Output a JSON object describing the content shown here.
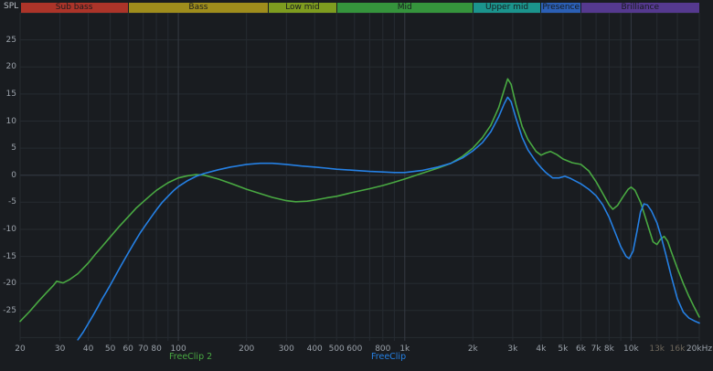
{
  "chart_data": {
    "type": "line",
    "title": "",
    "legend_position": "bottom",
    "colors": {
      "background": "#191c20",
      "grid": "#262b31",
      "grid_major": "#343a43",
      "grid_zero": "#363d46",
      "axis_text": "#9aa1a9"
    },
    "x_axis": {
      "scale": "log",
      "min": 20,
      "max": 20000,
      "unit": "Hz",
      "gridlines": [
        20,
        30,
        40,
        50,
        60,
        70,
        80,
        90,
        100,
        200,
        300,
        400,
        500,
        600,
        700,
        800,
        900,
        1000,
        2000,
        3000,
        4000,
        5000,
        6000,
        7000,
        8000,
        9000,
        10000,
        13000,
        16000,
        20000
      ],
      "major": [
        100,
        1000,
        10000
      ],
      "ticks": [
        {
          "f": 20,
          "label": "20"
        },
        {
          "f": 30,
          "label": "30"
        },
        {
          "f": 40,
          "label": "40"
        },
        {
          "f": 50,
          "label": "50"
        },
        {
          "f": 60,
          "label": "60"
        },
        {
          "f": 70,
          "label": "70"
        },
        {
          "f": 80,
          "label": "80"
        },
        {
          "f": 100,
          "label": "100"
        },
        {
          "f": 200,
          "label": "200"
        },
        {
          "f": 300,
          "label": "300"
        },
        {
          "f": 400,
          "label": "400"
        },
        {
          "f": 500,
          "label": "500"
        },
        {
          "f": 600,
          "label": "600"
        },
        {
          "f": 800,
          "label": "800"
        },
        {
          "f": 1000,
          "label": "1k"
        },
        {
          "f": 2000,
          "label": "2k"
        },
        {
          "f": 3000,
          "label": "3k"
        },
        {
          "f": 4000,
          "label": "4k"
        },
        {
          "f": 5000,
          "label": "5k"
        },
        {
          "f": 6000,
          "label": "6k"
        },
        {
          "f": 7000,
          "label": "7k"
        },
        {
          "f": 8000,
          "label": "8k"
        },
        {
          "f": 10000,
          "label": "10k"
        },
        {
          "f": 13000,
          "label": "13k",
          "dim": true
        },
        {
          "f": 16000,
          "label": "16k",
          "dim": true
        },
        {
          "f": 20000,
          "label": "20kHz"
        }
      ]
    },
    "y_axis": {
      "title": "SPL",
      "unit": "dB",
      "min": -30.6,
      "max": 30.0,
      "grid_step": 5,
      "ticks": [
        "25",
        "20",
        "15",
        "10",
        "5",
        "0",
        "-5",
        "-10",
        "-15",
        "-20",
        "-25"
      ]
    },
    "bands": [
      {
        "label": "Sub bass",
        "from": 20,
        "to": 60,
        "color": "#ac3429"
      },
      {
        "label": "Bass",
        "from": 60,
        "to": 250,
        "color": "#9f8d1c"
      },
      {
        "label": "Low mid",
        "from": 250,
        "to": 500,
        "color": "#7e9c1f"
      },
      {
        "label": "Mid",
        "from": 500,
        "to": 2000,
        "color": "#35943c"
      },
      {
        "label": "Upper mid",
        "from": 2000,
        "to": 4000,
        "color": "#1b948d"
      },
      {
        "label": "Presence",
        "from": 4000,
        "to": 6000,
        "color": "#2b5fb5"
      },
      {
        "label": "Brilliance",
        "from": 6000,
        "to": 20000,
        "color": "#55398f"
      }
    ],
    "series": [
      {
        "name": "FreeClip 2",
        "color": "#49a942",
        "points": [
          [
            20,
            -27.0
          ],
          [
            22,
            -25.2
          ],
          [
            24,
            -23.4
          ],
          [
            26,
            -21.8
          ],
          [
            28,
            -20.4
          ],
          [
            29,
            -19.6
          ],
          [
            31,
            -19.9
          ],
          [
            33,
            -19.3
          ],
          [
            36,
            -18.2
          ],
          [
            38,
            -17.2
          ],
          [
            40,
            -16.2
          ],
          [
            43,
            -14.6
          ],
          [
            46,
            -13.2
          ],
          [
            50,
            -11.4
          ],
          [
            55,
            -9.4
          ],
          [
            60,
            -7.7
          ],
          [
            65,
            -6.1
          ],
          [
            70,
            -4.9
          ],
          [
            75,
            -3.8
          ],
          [
            80,
            -2.8
          ],
          [
            90,
            -1.4
          ],
          [
            100,
            -0.5
          ],
          [
            110,
            -0.1
          ],
          [
            120,
            0.1
          ],
          [
            130,
            0.0
          ],
          [
            150,
            -0.7
          ],
          [
            170,
            -1.5
          ],
          [
            200,
            -2.6
          ],
          [
            230,
            -3.4
          ],
          [
            260,
            -4.1
          ],
          [
            300,
            -4.7
          ],
          [
            330,
            -4.9
          ],
          [
            370,
            -4.8
          ],
          [
            400,
            -4.6
          ],
          [
            450,
            -4.2
          ],
          [
            500,
            -3.9
          ],
          [
            600,
            -3.1
          ],
          [
            700,
            -2.5
          ],
          [
            800,
            -1.9
          ],
          [
            900,
            -1.3
          ],
          [
            1000,
            -0.7
          ],
          [
            1200,
            0.4
          ],
          [
            1400,
            1.3
          ],
          [
            1600,
            2.2
          ],
          [
            1800,
            3.5
          ],
          [
            2000,
            5.0
          ],
          [
            2200,
            6.9
          ],
          [
            2400,
            9.2
          ],
          [
            2600,
            12.5
          ],
          [
            2750,
            15.8
          ],
          [
            2850,
            17.8
          ],
          [
            2950,
            16.8
          ],
          [
            3100,
            13.0
          ],
          [
            3300,
            9.0
          ],
          [
            3500,
            6.6
          ],
          [
            3800,
            4.4
          ],
          [
            4000,
            3.7
          ],
          [
            4200,
            4.1
          ],
          [
            4400,
            4.4
          ],
          [
            4700,
            3.8
          ],
          [
            5000,
            3.0
          ],
          [
            5500,
            2.3
          ],
          [
            6000,
            2.0
          ],
          [
            6500,
            0.8
          ],
          [
            7000,
            -1.2
          ],
          [
            7500,
            -3.4
          ],
          [
            8000,
            -5.5
          ],
          [
            8300,
            -6.3
          ],
          [
            8700,
            -5.6
          ],
          [
            9200,
            -4.0
          ],
          [
            9700,
            -2.6
          ],
          [
            10000,
            -2.2
          ],
          [
            10400,
            -2.8
          ],
          [
            11000,
            -5.0
          ],
          [
            11500,
            -7.5
          ],
          [
            12000,
            -10.0
          ],
          [
            12500,
            -12.3
          ],
          [
            13000,
            -12.8
          ],
          [
            13500,
            -11.8
          ],
          [
            14000,
            -11.3
          ],
          [
            14500,
            -12.2
          ],
          [
            15000,
            -14.0
          ],
          [
            16000,
            -17.2
          ],
          [
            17000,
            -20.0
          ],
          [
            18000,
            -22.4
          ],
          [
            19000,
            -24.4
          ],
          [
            20000,
            -26.2
          ]
        ]
      },
      {
        "name": "FreeClip",
        "color": "#2580e4",
        "points": [
          [
            36,
            -30.4
          ],
          [
            38,
            -29.0
          ],
          [
            40,
            -27.4
          ],
          [
            42,
            -25.9
          ],
          [
            44,
            -24.4
          ],
          [
            46,
            -22.9
          ],
          [
            48,
            -21.6
          ],
          [
            50,
            -20.3
          ],
          [
            53,
            -18.4
          ],
          [
            56,
            -16.6
          ],
          [
            60,
            -14.4
          ],
          [
            64,
            -12.4
          ],
          [
            68,
            -10.6
          ],
          [
            72,
            -9.1
          ],
          [
            76,
            -7.7
          ],
          [
            80,
            -6.4
          ],
          [
            85,
            -5.0
          ],
          [
            90,
            -3.9
          ],
          [
            95,
            -2.9
          ],
          [
            100,
            -2.1
          ],
          [
            110,
            -1.0
          ],
          [
            120,
            -0.2
          ],
          [
            130,
            0.3
          ],
          [
            150,
            1.0
          ],
          [
            170,
            1.5
          ],
          [
            200,
            2.0
          ],
          [
            230,
            2.2
          ],
          [
            260,
            2.2
          ],
          [
            300,
            2.0
          ],
          [
            350,
            1.7
          ],
          [
            400,
            1.5
          ],
          [
            450,
            1.3
          ],
          [
            500,
            1.1
          ],
          [
            600,
            0.9
          ],
          [
            700,
            0.7
          ],
          [
            800,
            0.6
          ],
          [
            900,
            0.5
          ],
          [
            1000,
            0.5
          ],
          [
            1200,
            0.9
          ],
          [
            1400,
            1.5
          ],
          [
            1600,
            2.2
          ],
          [
            1800,
            3.2
          ],
          [
            2000,
            4.5
          ],
          [
            2200,
            6.0
          ],
          [
            2400,
            8.0
          ],
          [
            2600,
            10.8
          ],
          [
            2750,
            13.2
          ],
          [
            2850,
            14.4
          ],
          [
            2950,
            13.6
          ],
          [
            3100,
            10.5
          ],
          [
            3300,
            7.0
          ],
          [
            3500,
            4.7
          ],
          [
            3800,
            2.5
          ],
          [
            4000,
            1.4
          ],
          [
            4200,
            0.5
          ],
          [
            4500,
            -0.5
          ],
          [
            4800,
            -0.5
          ],
          [
            5100,
            -0.2
          ],
          [
            5400,
            -0.6
          ],
          [
            6000,
            -1.6
          ],
          [
            6500,
            -2.6
          ],
          [
            7000,
            -3.8
          ],
          [
            7500,
            -5.5
          ],
          [
            8000,
            -7.8
          ],
          [
            8500,
            -10.6
          ],
          [
            9000,
            -13.2
          ],
          [
            9500,
            -15.0
          ],
          [
            9800,
            -15.4
          ],
          [
            10200,
            -14.0
          ],
          [
            10600,
            -10.5
          ],
          [
            11000,
            -6.8
          ],
          [
            11400,
            -5.3
          ],
          [
            11800,
            -5.5
          ],
          [
            12300,
            -6.6
          ],
          [
            13000,
            -8.8
          ],
          [
            13600,
            -11.5
          ],
          [
            14200,
            -14.5
          ],
          [
            15000,
            -18.5
          ],
          [
            16000,
            -22.8
          ],
          [
            17000,
            -25.3
          ],
          [
            18000,
            -26.4
          ],
          [
            19000,
            -26.9
          ],
          [
            20000,
            -27.3
          ]
        ]
      }
    ]
  }
}
